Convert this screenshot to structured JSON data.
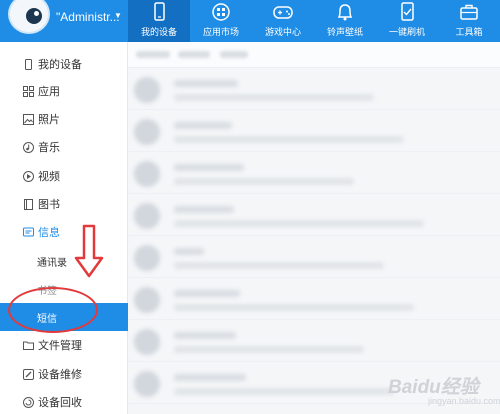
{
  "header": {
    "user_name": "\"Administr...",
    "nav": [
      {
        "label": "我的设备",
        "icon": "phone-icon",
        "active": true
      },
      {
        "label": "应用市场",
        "icon": "apps-icon",
        "active": false
      },
      {
        "label": "游戏中心",
        "icon": "gamepad-icon",
        "active": false
      },
      {
        "label": "铃声壁纸",
        "icon": "bell-icon",
        "active": false
      },
      {
        "label": "一键刷机",
        "icon": "flash-phone-icon",
        "active": false
      },
      {
        "label": "工具箱",
        "icon": "toolbox-icon",
        "active": false
      }
    ]
  },
  "sidebar": {
    "items": [
      {
        "label": "我的设备",
        "icon": "phone-outline-icon"
      },
      {
        "label": "应用",
        "icon": "grid-icon"
      },
      {
        "label": "照片",
        "icon": "image-icon"
      },
      {
        "label": "音乐",
        "icon": "music-icon"
      },
      {
        "label": "视频",
        "icon": "video-icon"
      },
      {
        "label": "图书",
        "icon": "book-icon"
      },
      {
        "label": "信息",
        "icon": "message-icon"
      },
      {
        "label": "通讯录",
        "icon": ""
      },
      {
        "label": "书签",
        "icon": ""
      },
      {
        "label": "短信",
        "icon": ""
      },
      {
        "label": "文件管理",
        "icon": "folder-icon"
      },
      {
        "label": "设备维修",
        "icon": "wrench-icon"
      },
      {
        "label": "设备回收",
        "icon": "recycle-icon"
      }
    ]
  },
  "watermark": {
    "brand": "Baidu经验",
    "sub": "jingyan.baidu.com"
  },
  "colors": {
    "accent": "#1f8ce6",
    "annotation": "#e23a3a"
  }
}
